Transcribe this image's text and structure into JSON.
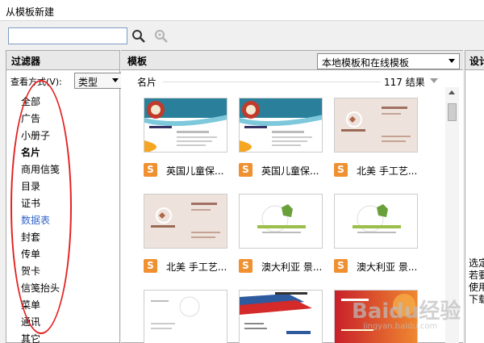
{
  "window": {
    "title": "从模板新建"
  },
  "search": {
    "placeholder": "",
    "value": ""
  },
  "filter_panel": {
    "header": "过滤器",
    "view_label": "查看方式(V):",
    "view_value": "类型",
    "items": [
      {
        "label": "全部",
        "bold": false
      },
      {
        "label": "广告",
        "bold": false
      },
      {
        "label": "小册子",
        "bold": false
      },
      {
        "label": "名片",
        "bold": true
      },
      {
        "label": "商用信笺",
        "bold": false
      },
      {
        "label": "目录",
        "bold": false
      },
      {
        "label": "证书",
        "bold": false
      },
      {
        "label": "数据表",
        "bold": false,
        "selected": true
      },
      {
        "label": "封套",
        "bold": false
      },
      {
        "label": "传单",
        "bold": false
      },
      {
        "label": "贺卡",
        "bold": false
      },
      {
        "label": "信笺抬头",
        "bold": false
      },
      {
        "label": "菜单",
        "bold": false
      },
      {
        "label": "通讯",
        "bold": false
      },
      {
        "label": "其它",
        "bold": false
      }
    ]
  },
  "template_panel": {
    "header": "模板",
    "source_select": "本地模板和在线模板",
    "group": {
      "name": "名片",
      "count": "117 结果"
    },
    "items": [
      {
        "label": "英国儿童保...",
        "style": "kids"
      },
      {
        "label": "英国儿童保...",
        "style": "kids"
      },
      {
        "label": "北美 手工艺...",
        "style": "craft"
      },
      {
        "label": "北美 手工艺...",
        "style": "craft"
      },
      {
        "label": "澳大利亚 景...",
        "style": "leaf"
      },
      {
        "label": "澳大利亚 景...",
        "style": "leaf"
      },
      {
        "label": "",
        "style": "plain"
      },
      {
        "label": "",
        "style": "travel"
      },
      {
        "label": "",
        "style": "red"
      }
    ],
    "icon_letter": "S"
  },
  "detail_panel": {
    "header": "设计",
    "lines": [
      "选定",
      "若要",
      "使用",
      "下载"
    ]
  },
  "colors": {
    "accent_orange": "#f09030",
    "selected_blue": "#3366cc",
    "annotation_red": "#e42222"
  },
  "watermark": {
    "text": "Baidu经验",
    "url": "jingyan.baidu.com"
  }
}
